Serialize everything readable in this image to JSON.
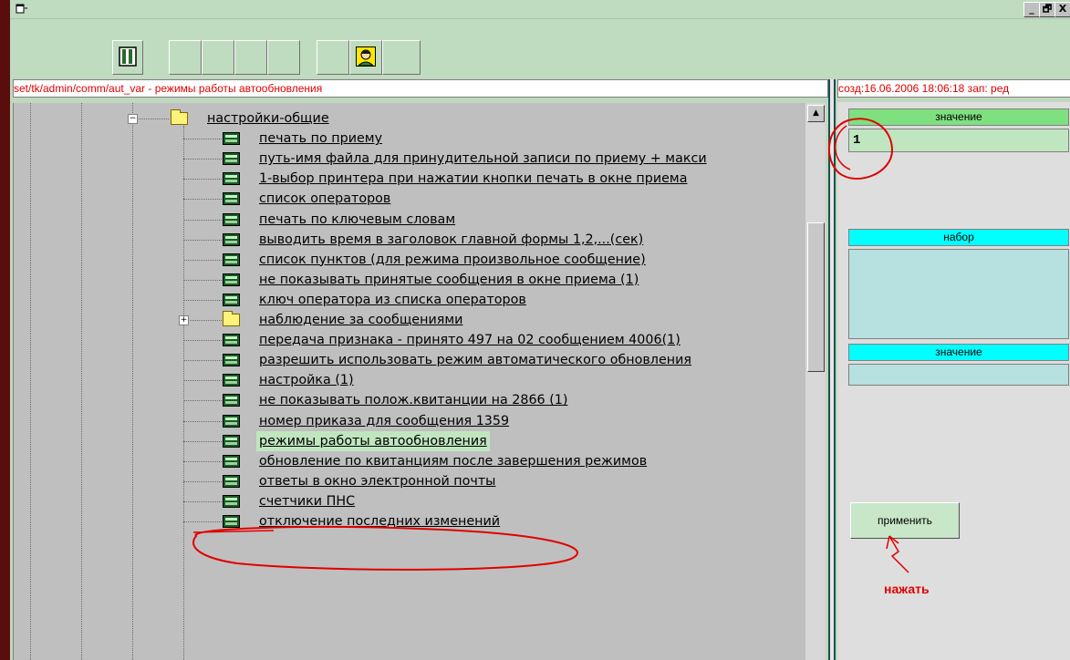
{
  "window": {
    "app_icon": "window-icon",
    "minimize": "_",
    "restore": "🗗",
    "close": "X"
  },
  "path": "set/tk/admin/comm/aut_var - режимы работы автообновления",
  "info": "созд:16.06.2006 18:06:18 зап: ред",
  "tree": {
    "root": {
      "label": "настройки-общие",
      "icon": "folder-icon",
      "expanded": true
    },
    "items": [
      {
        "label": "печать по приему",
        "icon": "setting-icon"
      },
      {
        "label": "путь-имя файла для принудительной записи по приему + макси",
        "icon": "setting-icon"
      },
      {
        "label": "1-выбор принтера при нажатии кнопки печать в окне приема",
        "icon": "setting-icon"
      },
      {
        "label": "список операторов",
        "icon": "setting-icon"
      },
      {
        "label": "печать по ключевым словам",
        "icon": "setting-icon"
      },
      {
        "label": "выводить время в заголовок главной формы 1,2,...(сек)",
        "icon": "setting-icon"
      },
      {
        "label": "список пунктов (для режима произвольное сообщение)",
        "icon": "setting-icon"
      },
      {
        "label": "не показывать принятые сообщения в окне приема (1)",
        "icon": "setting-icon"
      },
      {
        "label": "ключ оператора из списка операторов",
        "icon": "setting-icon"
      },
      {
        "label": "наблюдение за сообщениями",
        "icon": "folder-icon",
        "collapsed": true
      },
      {
        "label": "передача признака - принято 497 на 02 сообщением 4006(1)",
        "icon": "setting-icon"
      },
      {
        "label": "разрешить использовать режим автоматического обновления",
        "icon": "setting-icon"
      },
      {
        "label": "настройка (1)",
        "icon": "setting-icon"
      },
      {
        "label": "не показывать полож.квитанции на 2866 (1)",
        "icon": "setting-icon"
      },
      {
        "label": "номер приказа для сообщения 1359",
        "icon": "setting-icon"
      },
      {
        "label": "режимы работы автообновления",
        "icon": "setting-icon",
        "selected": true
      },
      {
        "label": "обновление по квитанциям после завершения режимов",
        "icon": "setting-icon"
      },
      {
        "label": "ответы в окно электронной почты",
        "icon": "setting-icon"
      },
      {
        "label": "счетчики ПНС",
        "icon": "setting-icon"
      },
      {
        "label": "отключение последних изменений",
        "icon": "setting-icon"
      }
    ]
  },
  "right": {
    "value_header": "значение",
    "value": "1",
    "set_header": "набор",
    "value2_header": "значение",
    "apply_label": "применить",
    "annotation": "нажать"
  },
  "colors": {
    "value_header_bg": "#7fe07f",
    "set_header_bg": "#00ffff",
    "set_box_bg": "#b7e0e0",
    "value_box_bg": "#c0e6c0",
    "annotation": "#e00000"
  }
}
